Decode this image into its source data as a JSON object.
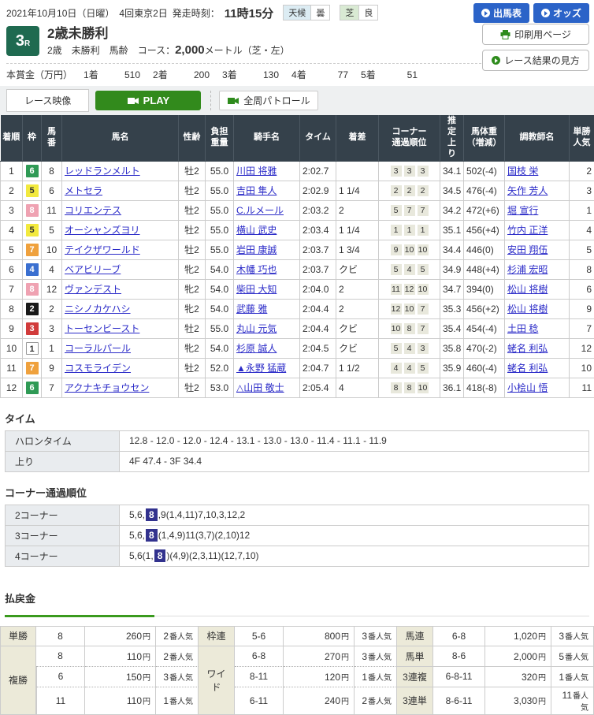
{
  "header": {
    "date_line": "2021年10月10日（日曜）　4回東京2日",
    "start_time_label": "発走時刻：",
    "start_time": "11時15分",
    "weather_label": "天候",
    "weather_value": "曇",
    "turf_label": "芝",
    "going_value": "良",
    "btn_entries": "出馬表",
    "btn_odds": "オッズ",
    "btn_print": "印刷用ページ",
    "btn_guide": "レース結果の見方",
    "race_number": "3",
    "race_number_suffix": "R",
    "race_name": "2歳未勝利",
    "race_conditions": "2歳　未勝利　馬齢",
    "course_label": "　コース：",
    "course_distance": "2,000",
    "course_suffix": "メートル（芝・左）",
    "prize_label": "本賞金（万円）",
    "prize_items": [
      {
        "place": "1着",
        "amount": "510"
      },
      {
        "place": "2着",
        "amount": "200"
      },
      {
        "place": "3着",
        "amount": "130"
      },
      {
        "place": "4着",
        "amount": "77"
      },
      {
        "place": "5着",
        "amount": "51"
      }
    ]
  },
  "video": {
    "label": "レース映像",
    "play": "PLAY",
    "patrol": "全周パトロール"
  },
  "results": {
    "columns": [
      "着順",
      "枠",
      "馬\n番",
      "馬名",
      "性齢",
      "負担\n重量",
      "騎手名",
      "タイム",
      "着差",
      "コーナー\n通過順位",
      "推\n定\n上\nり",
      "馬体重\n（増減）",
      "調教師名",
      "単勝\n人気"
    ],
    "rows": [
      {
        "pos": "1",
        "frame": "6",
        "num": "8",
        "horse": "レッドランメルト",
        "sexage": "牡2",
        "weight": "55.0",
        "jockey": "川田 将雅",
        "time": "2:02.7",
        "margin": "",
        "corners": [
          "3",
          "3",
          "3"
        ],
        "last3f": "34.1",
        "hweight": "502(-4)",
        "trainer": "国枝 栄",
        "fav": "2"
      },
      {
        "pos": "2",
        "frame": "5",
        "num": "6",
        "horse": "メトセラ",
        "sexage": "牡2",
        "weight": "55.0",
        "jockey": "吉田 隼人",
        "time": "2:02.9",
        "margin": "1 1/4",
        "corners": [
          "2",
          "2",
          "2"
        ],
        "last3f": "34.5",
        "hweight": "476(-4)",
        "trainer": "矢作 芳人",
        "fav": "3"
      },
      {
        "pos": "3",
        "frame": "8",
        "num": "11",
        "horse": "コリエンテス",
        "sexage": "牡2",
        "weight": "55.0",
        "jockey": "C.ルメール",
        "time": "2:03.2",
        "margin": "2",
        "corners": [
          "5",
          "7",
          "7"
        ],
        "last3f": "34.2",
        "hweight": "472(+6)",
        "trainer": "堀 宣行",
        "fav": "1"
      },
      {
        "pos": "4",
        "frame": "5",
        "num": "5",
        "horse": "オーシャンズヨリ",
        "sexage": "牡2",
        "weight": "55.0",
        "jockey": "横山 武史",
        "time": "2:03.4",
        "margin": "1 1/4",
        "corners": [
          "1",
          "1",
          "1"
        ],
        "last3f": "35.1",
        "hweight": "456(+4)",
        "trainer": "竹内 正洋",
        "fav": "4"
      },
      {
        "pos": "5",
        "frame": "7",
        "num": "10",
        "horse": "テイクザワールド",
        "sexage": "牡2",
        "weight": "55.0",
        "jockey": "岩田 康誠",
        "time": "2:03.7",
        "margin": "1 3/4",
        "corners": [
          "9",
          "10",
          "10"
        ],
        "last3f": "34.4",
        "hweight": "446(0)",
        "trainer": "安田 翔伍",
        "fav": "5"
      },
      {
        "pos": "6",
        "frame": "4",
        "num": "4",
        "horse": "ベアビリーブ",
        "sexage": "牝2",
        "weight": "54.0",
        "jockey": "木幡 巧也",
        "time": "2:03.7",
        "margin": "クビ",
        "corners": [
          "5",
          "4",
          "5"
        ],
        "last3f": "34.9",
        "hweight": "448(+4)",
        "trainer": "杉浦 宏昭",
        "fav": "8"
      },
      {
        "pos": "7",
        "frame": "8",
        "num": "12",
        "horse": "ヴァンデスト",
        "sexage": "牝2",
        "weight": "54.0",
        "jockey": "柴田 大知",
        "time": "2:04.0",
        "margin": "2",
        "corners": [
          "11",
          "12",
          "10"
        ],
        "last3f": "34.7",
        "hweight": "394(0)",
        "trainer": "松山 将樹",
        "fav": "6"
      },
      {
        "pos": "8",
        "frame": "2",
        "num": "2",
        "horse": "ニシノカケハシ",
        "sexage": "牝2",
        "weight": "54.0",
        "jockey": "武藤 雅",
        "time": "2:04.4",
        "margin": "2",
        "corners": [
          "12",
          "10",
          "7"
        ],
        "last3f": "35.3",
        "hweight": "456(+2)",
        "trainer": "松山 将樹",
        "fav": "9"
      },
      {
        "pos": "9",
        "frame": "3",
        "num": "3",
        "horse": "トーセンビースト",
        "sexage": "牡2",
        "weight": "55.0",
        "jockey": "丸山 元気",
        "time": "2:04.4",
        "margin": "クビ",
        "corners": [
          "10",
          "8",
          "7"
        ],
        "last3f": "35.4",
        "hweight": "454(-4)",
        "trainer": "土田 稔",
        "fav": "7"
      },
      {
        "pos": "10",
        "frame": "1",
        "num": "1",
        "horse": "コーラルパール",
        "sexage": "牝2",
        "weight": "54.0",
        "jockey": "杉原 誠人",
        "time": "2:04.5",
        "margin": "クビ",
        "corners": [
          "5",
          "4",
          "3"
        ],
        "last3f": "35.8",
        "hweight": "470(-2)",
        "trainer": "蛯名 利弘",
        "fav": "12"
      },
      {
        "pos": "11",
        "frame": "7",
        "num": "9",
        "horse": "コスモライデン",
        "sexage": "牡2",
        "weight": "52.0",
        "jockey": "▲永野 猛蔵",
        "time": "2:04.7",
        "margin": "1 1/2",
        "corners": [
          "4",
          "4",
          "5"
        ],
        "last3f": "35.9",
        "hweight": "460(-4)",
        "trainer": "蛯名 利弘",
        "fav": "10"
      },
      {
        "pos": "12",
        "frame": "6",
        "num": "7",
        "horse": "アクナキチョウセン",
        "sexage": "牡2",
        "weight": "53.0",
        "jockey": "△山田 敬士",
        "time": "2:05.4",
        "margin": "4",
        "corners": [
          "8",
          "8",
          "10"
        ],
        "last3f": "36.1",
        "hweight": "418(-8)",
        "trainer": "小桧山 悟",
        "fav": "11"
      }
    ]
  },
  "time_section": {
    "title": "タイム",
    "rows": [
      {
        "label": "ハロンタイム",
        "value": "12.8 - 12.0 - 12.0 - 12.4 - 13.1 - 13.0 - 13.0 - 11.4 - 11.1 - 11.9"
      },
      {
        "label": "上り",
        "value": "4F 47.4 - 3F 34.4"
      }
    ]
  },
  "corner_section": {
    "title": "コーナー通過順位",
    "rows": [
      {
        "label": "2コーナー",
        "pre": "5,6,",
        "hl": "8",
        "post": ",9(1,4,11)7,10,3,12,2"
      },
      {
        "label": "3コーナー",
        "pre": "5,6,",
        "hl": "8",
        "post": "(1,4,9)11(3,7)(2,10)12"
      },
      {
        "label": "4コーナー",
        "pre": "5,6(1,",
        "hl": "8",
        "post": ")(4,9)(2,3,11)(12,7,10)"
      }
    ]
  },
  "payout": {
    "title": "払戻金",
    "yen": "円",
    "fav_suffix": "番人気",
    "tansho": {
      "label": "単勝",
      "sel": "8",
      "amount": "260",
      "fav": "2"
    },
    "fukusho": {
      "label": "複勝",
      "rows": [
        {
          "sel": "8",
          "amount": "110",
          "fav": "2"
        },
        {
          "sel": "6",
          "amount": "150",
          "fav": "3"
        },
        {
          "sel": "11",
          "amount": "110",
          "fav": "1"
        }
      ]
    },
    "wakuren": {
      "label": "枠連",
      "sel": "5-6",
      "amount": "800",
      "fav": "3"
    },
    "wide": {
      "label": "ワイド",
      "rows": [
        {
          "sel": "6-8",
          "amount": "270",
          "fav": "3"
        },
        {
          "sel": "8-11",
          "amount": "120",
          "fav": "1"
        },
        {
          "sel": "6-11",
          "amount": "240",
          "fav": "2"
        }
      ]
    },
    "umaren": {
      "label": "馬連",
      "sel": "6-8",
      "amount": "1,020",
      "fav": "3"
    },
    "umatan": {
      "label": "馬単",
      "sel": "8-6",
      "amount": "2,000",
      "fav": "5"
    },
    "sanrenpuku": {
      "label": "3連複",
      "sel": "6-8-11",
      "amount": "320",
      "fav": "1"
    },
    "sanrentan": {
      "label": "3連単",
      "sel": "8-6-11",
      "amount": "3,030",
      "fav": "11"
    }
  },
  "colors": {
    "accent_blue": "#2b63c8",
    "accent_green": "#328a1c",
    "badge_green": "#1f6a50",
    "table_header": "#35414b",
    "highlight_navy": "#32328e",
    "link_blue": "#2b2bc8"
  }
}
